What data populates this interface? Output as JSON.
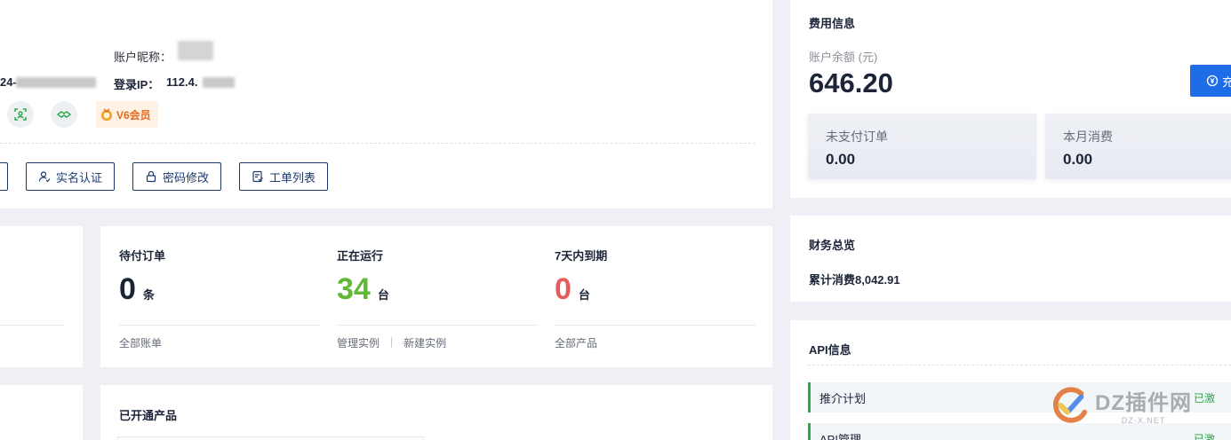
{
  "profile": {
    "nickname_label": "账户昵称：",
    "id_partial": "24-",
    "login_ip_label": "登录IP：",
    "login_ip_partial": "112.4.",
    "vip_label": "V6会员",
    "icons": [
      "face-scan-icon",
      "handshake-icon",
      "medal-icon"
    ]
  },
  "actions": {
    "real_name": "实名认证",
    "password": "密码修改",
    "tickets": "工单列表"
  },
  "stats": [
    {
      "label": "待付订单",
      "value": "0",
      "unit": "条",
      "color": "#1c2438",
      "links": [
        "全部账单"
      ]
    },
    {
      "label": "正在运行",
      "value": "34",
      "unit": "台",
      "color": "#5fb936",
      "links": [
        "管理实例",
        "新建实例"
      ]
    },
    {
      "label": "7天内到期",
      "value": "0",
      "unit": "台",
      "color": "#e35d5d",
      "links": [
        "全部产品"
      ]
    }
  ],
  "link_separator": "|",
  "products": {
    "title": "已开通产品"
  },
  "billing": {
    "title": "费用信息",
    "balance_label": "账户余额 (元)",
    "balance_value": "646.20",
    "recharge_label": "充",
    "unpaid_label": "未支付订单",
    "unpaid_value": "0.00",
    "month_label": "本月消费",
    "month_value": "0.00"
  },
  "finance": {
    "title": "财务总览",
    "total_text": "累计消费8,042.91"
  },
  "api": {
    "title": "API信息",
    "rows": [
      {
        "label": "推介计划",
        "status": "已激"
      },
      {
        "label": "API管理",
        "status": "已激"
      }
    ]
  },
  "watermark": {
    "text": "DZ插件网",
    "sub": "DZ-X.NET"
  }
}
